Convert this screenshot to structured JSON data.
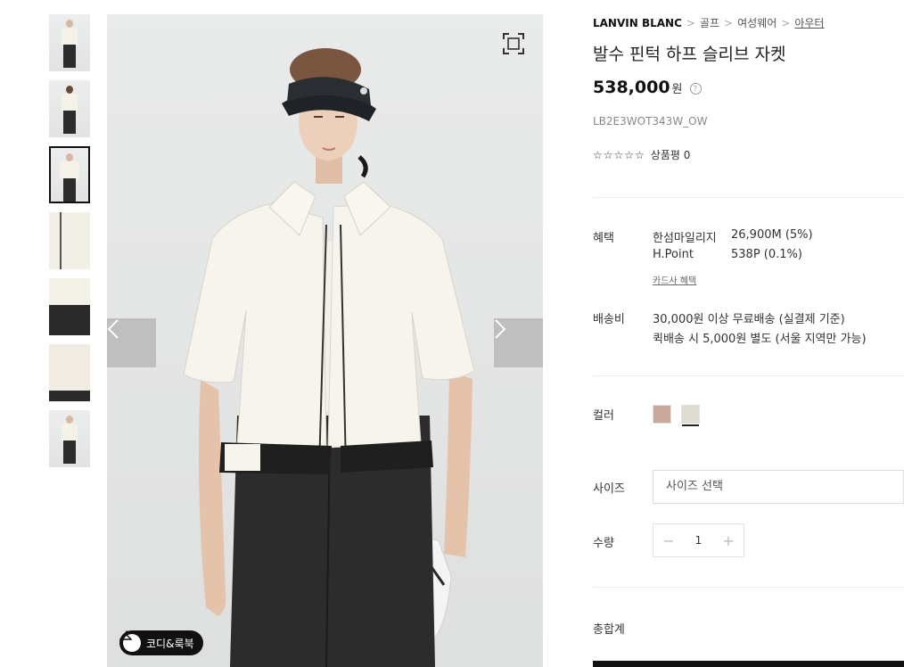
{
  "thumbnails": [
    {
      "kind": "full-body"
    },
    {
      "kind": "full-body-back"
    },
    {
      "kind": "full-body",
      "selected": true
    },
    {
      "kind": "detail"
    },
    {
      "kind": "detail-hem"
    },
    {
      "kind": "detail-side"
    },
    {
      "kind": "full-body"
    }
  ],
  "gallery": {
    "expand_icon": "expand-icon",
    "prev_icon": "chevron-left-icon",
    "next_icon": "chevron-right-icon",
    "coordi_label": "코디&룩북"
  },
  "breadcrumb": {
    "brand": "LANVIN BLANC",
    "items": [
      "골프",
      "여성웨어",
      "아우터"
    ]
  },
  "product": {
    "title": "발수 핀턱 하프 슬리브 자켓",
    "price": "538,000",
    "currency": "원",
    "code": "LB2E3WOT343W_OW",
    "stars": "☆☆☆☆☆",
    "review_label": "상품평 0"
  },
  "benefits": {
    "label": "혜택",
    "rows": [
      {
        "name": "한섬마일리지",
        "value": "26,900M (5%)"
      },
      {
        "name": "H.Point",
        "value": "538P (0.1%)"
      }
    ],
    "card_link": "카드사 혜택"
  },
  "shipping": {
    "label": "배송비",
    "line1": "30,000원 이상 무료배송 (실결제 기준)",
    "line2": "퀵배송 시 5,000원 별도 (서울 지역만 가능)"
  },
  "color": {
    "label": "컬러",
    "swatches": [
      "#c9a89c",
      "#dedbd0"
    ],
    "selected_index": 1
  },
  "size": {
    "label": "사이즈",
    "placeholder": "사이즈 선택"
  },
  "quantity": {
    "label": "수량",
    "value": "1",
    "minus": "−",
    "plus": "+"
  },
  "total": {
    "label": "총합계"
  }
}
